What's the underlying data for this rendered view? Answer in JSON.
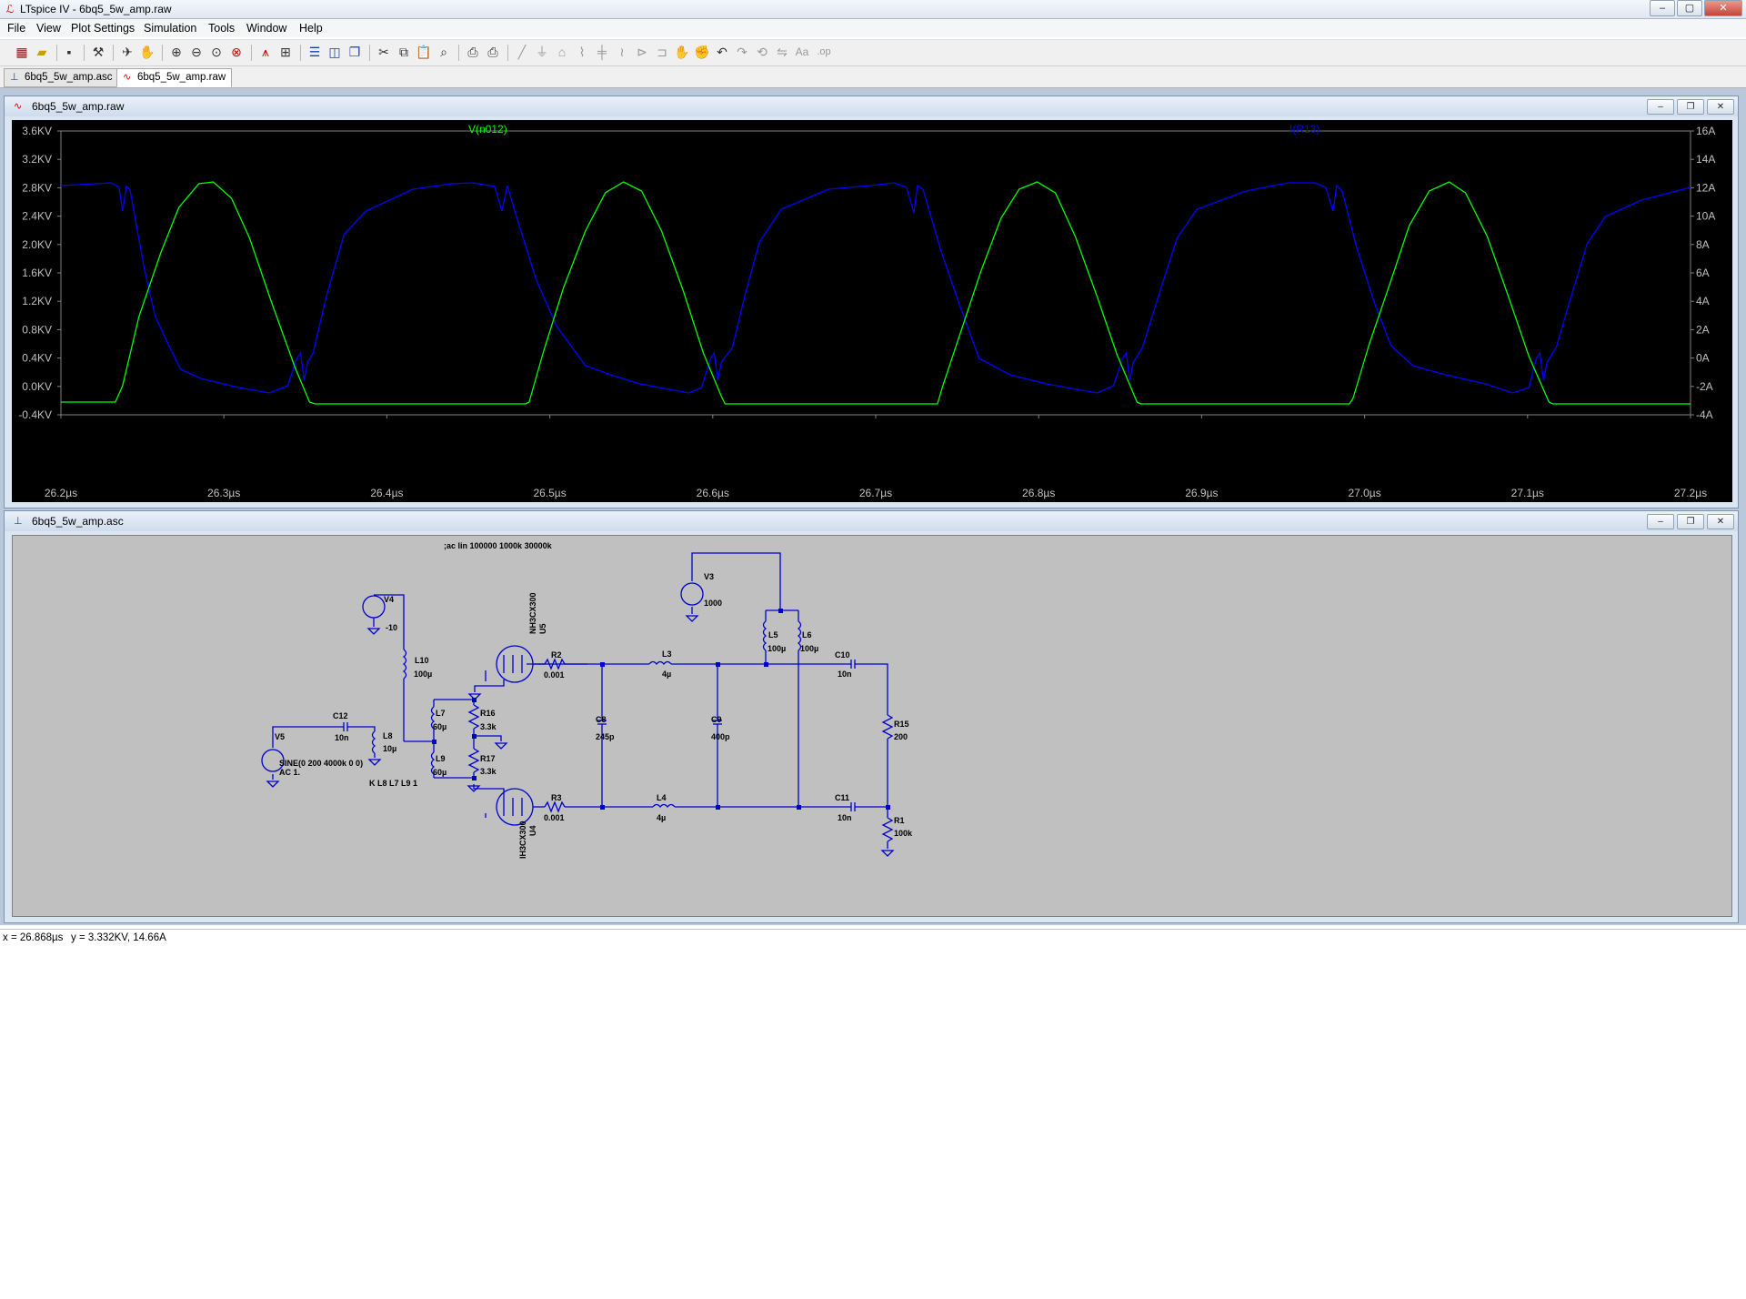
{
  "window": {
    "title": "LTspice IV - 6bq5_5w_amp.raw",
    "minimize": "–",
    "maximize": "▢",
    "close": "✕"
  },
  "menu": [
    "File",
    "View",
    "Plot Settings",
    "Simulation",
    "Tools",
    "Window",
    "Help"
  ],
  "toolbar": {
    "icons": [
      "new-schematic",
      "open",
      "save",
      "control-panel",
      "run",
      "pan",
      "zoom-in",
      "zoom-out",
      "zoom-fit",
      "zoom-cancel",
      "autoscale",
      "sheet",
      "tile-horizontal",
      "tile-vertical",
      "cascade",
      "cut",
      "copy",
      "paste",
      "find",
      "print-preview",
      "print",
      "wire",
      "ground",
      "label",
      "resistor",
      "capacitor",
      "inductor",
      "diode",
      "component",
      "move",
      "drag",
      "undo",
      "redo",
      "rotate",
      "mirror",
      "text",
      "spice-directive"
    ]
  },
  "tabs": [
    {
      "label": "6bq5_5w_amp.asc",
      "icon": "schematic-icon",
      "active": false
    },
    {
      "label": "6bq5_5w_amp.raw",
      "icon": "waveform-icon",
      "active": true
    }
  ],
  "waveform": {
    "title": "6bq5_5w_amp.raw",
    "traces": [
      {
        "name": "V(n012)",
        "color": "#00ff00"
      },
      {
        "name": "I(R13)",
        "color": "#0000ff"
      }
    ],
    "x_ticks": [
      "26.2µs",
      "26.3µs",
      "26.4µs",
      "26.5µs",
      "26.6µs",
      "26.7µs",
      "26.8µs",
      "26.9µs",
      "27.0µs",
      "27.1µs",
      "27.2µs"
    ],
    "y_left_ticks": [
      "3.6KV",
      "3.2KV",
      "2.8KV",
      "2.4KV",
      "2.0KV",
      "1.6KV",
      "1.2KV",
      "0.8KV",
      "0.4KV",
      "0.0KV",
      "-0.4KV"
    ],
    "y_right_ticks": [
      "16A",
      "14A",
      "12A",
      "10A",
      "8A",
      "6A",
      "4A",
      "2A",
      "0A",
      "-2A",
      "-4A"
    ]
  },
  "schematic": {
    "title": "6bq5_5w_amp.asc",
    "directive": ";ac lin 100000 1000k 30000k",
    "labels": {
      "V3": "V3",
      "V3_val": "1000",
      "V4": "V4",
      "V4_val": "-10",
      "V5": "V5",
      "V5_val1": "SINE(0 200 4000k 0 0)",
      "V5_val2": "AC 1.",
      "U5_model": "NH3CX300",
      "U5": "U5",
      "U4_model": "IH3CX300",
      "U4": "U4",
      "L10": "L10",
      "L10_val": "100µ",
      "C12": "C12",
      "C12_val": "10n",
      "L8": "L8",
      "L8_val": "10µ",
      "L7": "L7",
      "L7_val": "60µ",
      "L9": "L9",
      "L9_val": "60µ",
      "R16": "R16",
      "R16_val": "3.3k",
      "R17": "R17",
      "R17_val": "3.3k",
      "K": "K L8 L7 L9 1",
      "R2": "R2",
      "R2_val": "0.001",
      "R3": "R3",
      "R3_val": "0.001",
      "L3": "L3",
      "L3_val": "4µ",
      "L4": "L4",
      "L4_val": "4µ",
      "C8": "C8",
      "C8_val": "245p",
      "C9": "C9",
      "C9_val": "400p",
      "L5": "L5",
      "L5_val": "100µ",
      "L6": "L6",
      "L6_val": "100µ",
      "C10": "C10",
      "C10_val": "10n",
      "C11": "C11",
      "C11_val": "10n",
      "R15": "R15",
      "R15_val": "200",
      "R1": "R1",
      "R1_val": "100k"
    }
  },
  "status": {
    "x": "x = 26.868µs",
    "y": "y = 3.332KV, 14.66A"
  }
}
